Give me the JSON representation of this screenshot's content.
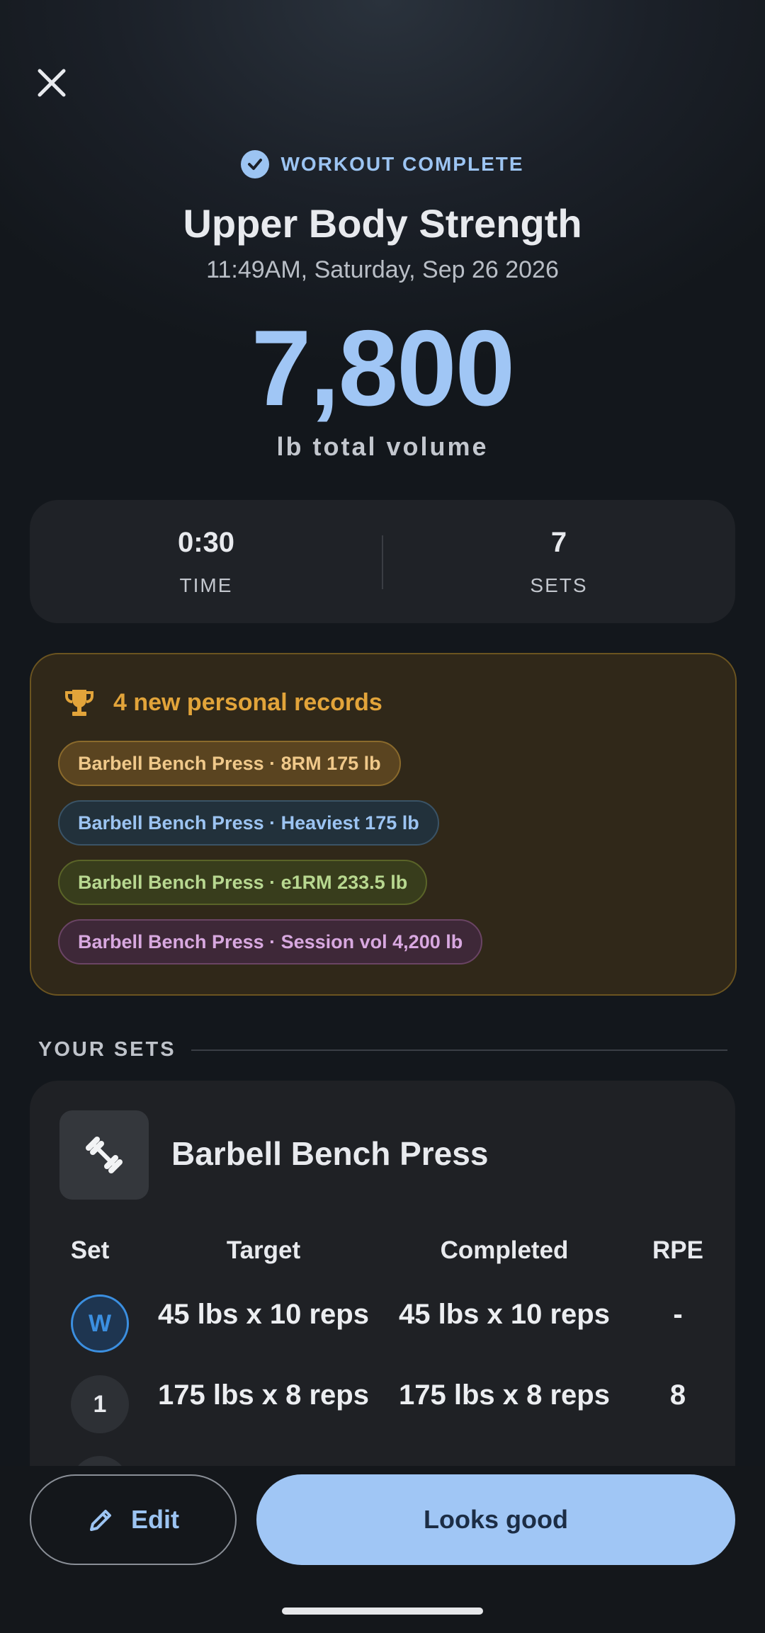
{
  "header": {
    "status_label": "WORKOUT COMPLETE",
    "title": "Upper Body Strength",
    "datetime": "11:49AM, Saturday, Sep 26 2026",
    "total_volume": "7,800",
    "volume_label": "lb total volume"
  },
  "stats": [
    {
      "value": "0:30",
      "label": "TIME"
    },
    {
      "value": "7",
      "label": "SETS"
    }
  ],
  "records": {
    "title": "4 new personal records",
    "chips": [
      {
        "label": "Barbell Bench Press · 8RM 175 lb",
        "color": "#f0c98a"
      },
      {
        "label": "Barbell Bench Press · Heaviest 175 lb",
        "color": "#9cc4f2"
      },
      {
        "label": "Barbell Bench Press · e1RM 233.5 lb",
        "color": "#b8d890"
      },
      {
        "label": "Barbell Bench Press · Session vol 4,200 lb",
        "color": "#d8a8e0"
      }
    ]
  },
  "sets_section": {
    "heading": "YOUR SETS",
    "exercise": {
      "name": "Barbell Bench Press",
      "icon": "dumbbell-icon",
      "columns": [
        "Set",
        "Target",
        "Completed",
        "RPE"
      ],
      "rows": [
        {
          "set": "W",
          "target": "45 lbs x 10 reps",
          "completed": "45 lbs x 10 reps",
          "rpe": "-"
        },
        {
          "set": "1",
          "target": "175 lbs x 8 reps",
          "completed": "175 lbs x 8 reps",
          "rpe": "8"
        }
      ]
    }
  },
  "actions": {
    "edit_label": "Edit",
    "confirm_label": "Looks good"
  },
  "colors": {
    "accent": "#a0c6f5",
    "pr_gold": "#e2a43a",
    "warmup_blue": "#3b8fe0"
  }
}
